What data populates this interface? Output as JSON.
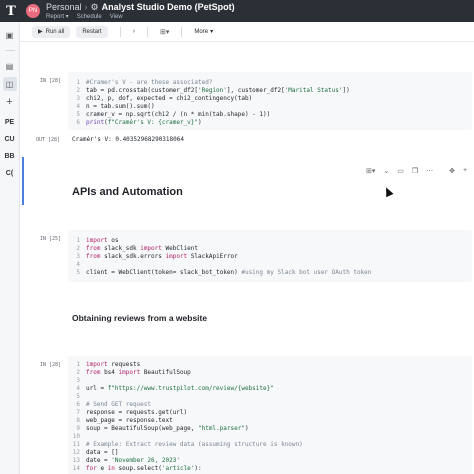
{
  "header": {
    "logo": "T",
    "avatar_initials": "PN",
    "workspace": "Personal",
    "separator": "›",
    "app_icon": "analyst-icon",
    "title": "Analyst Studio Demo (PetSpot)",
    "nav": [
      "Report ▾",
      "Schedule",
      "View"
    ]
  },
  "rail": {
    "icons": [
      "panel-icon",
      "database-icon",
      "schema-icon",
      "add-icon"
    ],
    "labels": [
      "PE",
      "CU",
      "BB",
      "C("
    ]
  },
  "toolbar": {
    "run_all": "Run all",
    "restart": "Restart",
    "more": "More"
  },
  "cells": [
    {
      "label": "IN [28]",
      "lines": [
        [
          [
            "c-comment",
            "#Cramer's V - are these associated?"
          ]
        ],
        [
          [
            "c-plain",
            "tab = pd.crosstab(customer_df2["
          ],
          [
            "c-str",
            "'Region'"
          ],
          [
            "c-plain",
            "], customer_df2["
          ],
          [
            "c-str",
            "'Marital Status'"
          ],
          [
            "c-plain",
            "])"
          ]
        ],
        [
          [
            "c-plain",
            "chi2, p, dof, expected = chi2_contingency(tab)"
          ]
        ],
        [
          [
            "c-plain",
            "n = tab.sum().sum()"
          ]
        ],
        [
          [
            "c-plain",
            "cramer_v = np.sqrt(chi2 / (n * min(tab.shape) - 1))"
          ]
        ],
        [
          [
            "c-fn",
            "print"
          ],
          [
            "c-plain",
            "("
          ],
          [
            "c-str",
            "f\"Cramér's V: {cramer_v}\""
          ],
          [
            "c-plain",
            ")"
          ]
        ]
      ]
    },
    {
      "label": "IN [25]",
      "lines": [
        [
          [
            "c-kw",
            "import"
          ],
          [
            "c-plain",
            " os"
          ]
        ],
        [
          [
            "c-kw",
            "from"
          ],
          [
            "c-plain",
            " slack_sdk "
          ],
          [
            "c-kw",
            "import"
          ],
          [
            "c-plain",
            " WebClient"
          ]
        ],
        [
          [
            "c-kw",
            "from"
          ],
          [
            "c-plain",
            " slack_sdk.errors "
          ],
          [
            "c-kw",
            "import"
          ],
          [
            "c-plain",
            " SlackApiError"
          ]
        ],
        [
          [
            "c-plain",
            ""
          ]
        ],
        [
          [
            "c-plain",
            "client = WebClient(token= slack_bot_token) "
          ],
          [
            "c-comment",
            "#using my Slack bot user OAuth token"
          ]
        ]
      ]
    },
    {
      "label": "IN [28]",
      "lines": [
        [
          [
            "c-kw",
            "import"
          ],
          [
            "c-plain",
            " requests"
          ]
        ],
        [
          [
            "c-kw",
            "from"
          ],
          [
            "c-plain",
            " bs4 "
          ],
          [
            "c-kw",
            "import"
          ],
          [
            "c-plain",
            " BeautifulSoup"
          ]
        ],
        [
          [
            "c-plain",
            ""
          ]
        ],
        [
          [
            "c-plain",
            "url = "
          ],
          [
            "c-str",
            "f\"https://www.trustpilot.com/review/{website}\""
          ]
        ],
        [
          [
            "c-plain",
            ""
          ]
        ],
        [
          [
            "c-comment",
            "# Send GET request"
          ]
        ],
        [
          [
            "c-plain",
            "response = requests.get(url)"
          ]
        ],
        [
          [
            "c-plain",
            "web_page = response.text"
          ]
        ],
        [
          [
            "c-plain",
            "soup = BeautifulSoup(web_page, "
          ],
          [
            "c-str",
            "\"html.parser\""
          ],
          [
            "c-plain",
            ")"
          ]
        ],
        [
          [
            "c-plain",
            ""
          ]
        ],
        [
          [
            "c-comment",
            "# Example: Extract review data (assuming structure is known)"
          ]
        ],
        [
          [
            "c-plain",
            "data = []"
          ]
        ],
        [
          [
            "c-plain",
            "date = "
          ],
          [
            "c-str",
            "'November 26, 2023'"
          ]
        ],
        [
          [
            "c-kw",
            "for"
          ],
          [
            "c-plain",
            " e "
          ],
          [
            "c-kw",
            "in"
          ],
          [
            "c-plain",
            " soup.select("
          ],
          [
            "c-str",
            "'article'"
          ],
          [
            "c-plain",
            "):"
          ]
        ]
      ]
    }
  ],
  "output": {
    "label": "OUT [28]",
    "text": "Cramér's V: 0.40352968290318064"
  },
  "headings": {
    "apis": "APIs and Automation",
    "reviews": "Obtaining reviews from a website"
  },
  "colors": {
    "header_bg": "#2b2f36",
    "selection": "#4a7fe0",
    "keyword": "#b3226b",
    "string": "#1e6f3f"
  }
}
